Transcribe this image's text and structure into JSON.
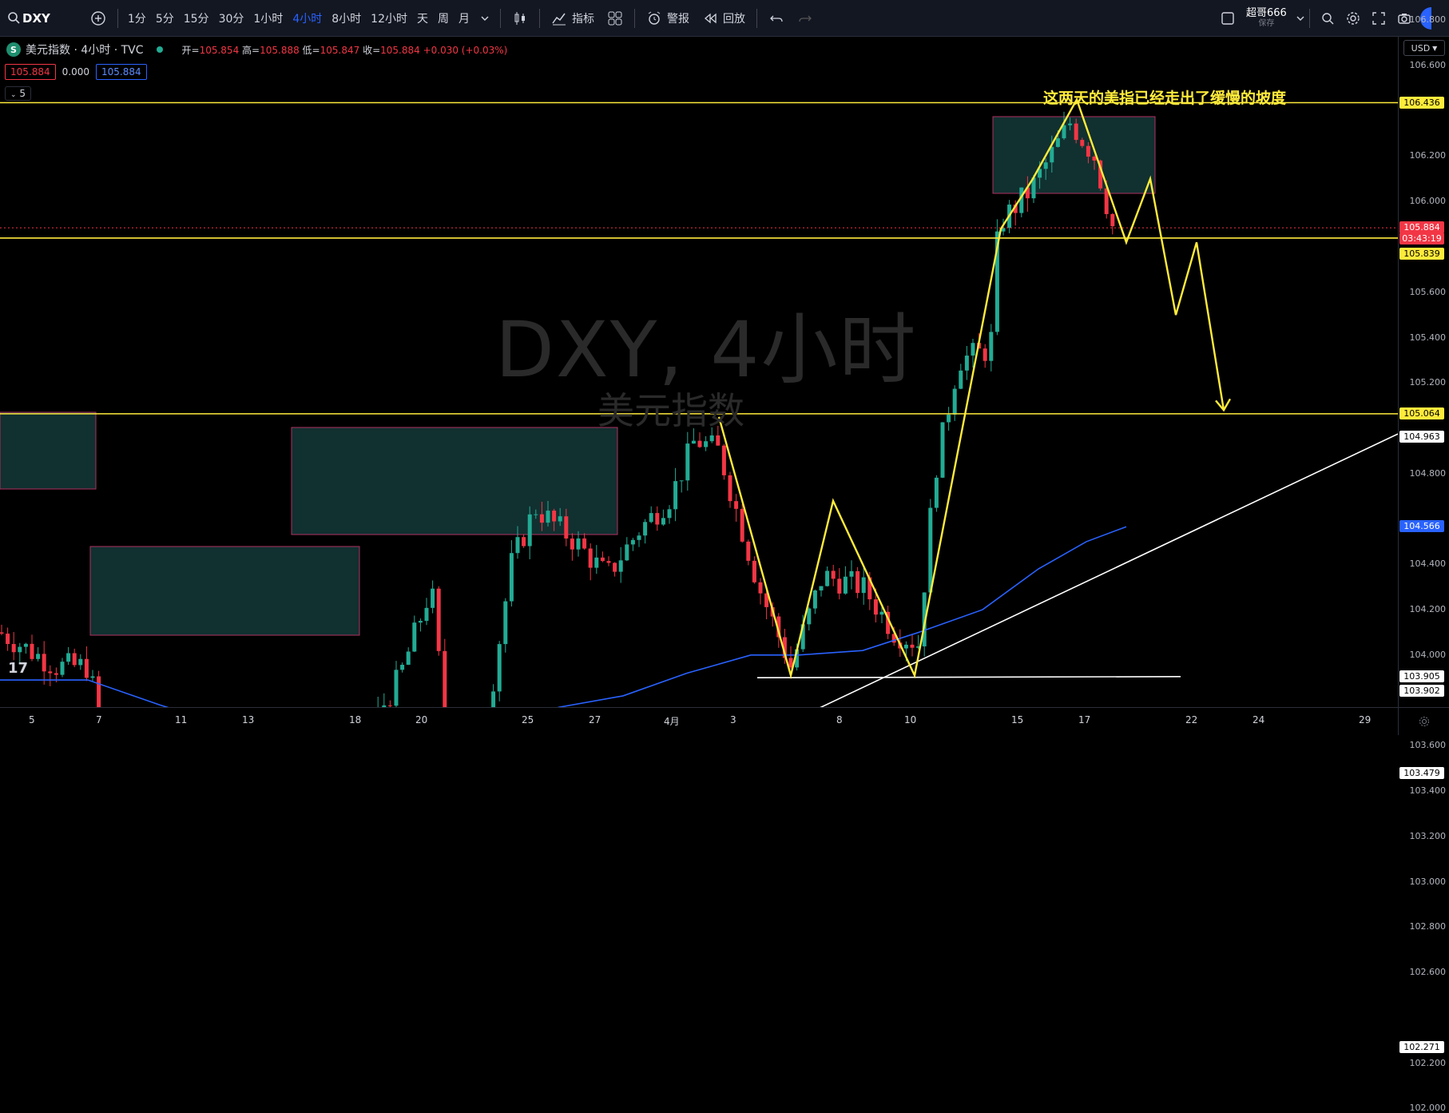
{
  "toolbar": {
    "symbol": "DXY",
    "intervals": [
      "1分",
      "5分",
      "15分",
      "30分",
      "1小时",
      "4小时",
      "8小时",
      "12小时",
      "天",
      "周",
      "月"
    ],
    "active_interval": "4小时",
    "indicators_label": "指标",
    "alert_label": "警报",
    "replay_label": "回放",
    "user_name": "超哥666",
    "save_label": "保存"
  },
  "legend": {
    "symbol_badge": "S",
    "title": "美元指数 · 4小时 · TVC",
    "open_k": "开=",
    "open_v": "105.854",
    "high_k": "高=",
    "high_v": "105.888",
    "low_k": "低=",
    "low_v": "105.847",
    "close_k": "收=",
    "close_v": "105.884",
    "change": "+0.030 (+0.03%)",
    "sell": "105.884",
    "spread": "0.000",
    "buy": "105.884",
    "collapse": "5"
  },
  "watermark": {
    "line1": "DXY, 4小时",
    "line2": "美元指数"
  },
  "annotation": "这两天的美指已经走出了缓慢的坡度",
  "currency": "USD",
  "price_axis": {
    "labels": [
      "106.800",
      "106.600",
      "106.200",
      "106.000",
      "105.600",
      "105.400",
      "105.200",
      "104.800",
      "104.400",
      "104.200",
      "104.000",
      "103.600",
      "103.400",
      "103.200",
      "103.000",
      "102.800",
      "102.600",
      "102.200",
      "102.000"
    ],
    "values": [
      106.8,
      106.6,
      106.2,
      106.0,
      105.6,
      105.4,
      105.2,
      104.8,
      104.4,
      104.2,
      104.0,
      103.6,
      103.4,
      103.2,
      103.0,
      102.8,
      102.6,
      102.2,
      102.0
    ]
  },
  "price_tags": [
    {
      "text": "106.436",
      "value": 106.436,
      "kind": "yellow"
    },
    {
      "text": "105.884",
      "value": 105.884,
      "kind": "red"
    },
    {
      "text": "03:43:19",
      "value": 105.8,
      "kind": "red"
    },
    {
      "text": "105.839",
      "value": 105.839,
      "kind": "yellow"
    },
    {
      "text": "105.064",
      "value": 105.064,
      "kind": "yellow"
    },
    {
      "text": "104.963",
      "value": 104.963,
      "kind": "white"
    },
    {
      "text": "104.566",
      "value": 104.566,
      "kind": "blue"
    },
    {
      "text": "103.905",
      "value": 103.905,
      "kind": "white"
    },
    {
      "text": "103.902",
      "value": 103.902,
      "kind": "white"
    },
    {
      "text": "103.479",
      "value": 103.479,
      "kind": "white"
    },
    {
      "text": "102.271",
      "value": 102.271,
      "kind": "white"
    }
  ],
  "time_axis": [
    "5",
    "7",
    "11",
    "13",
    "18",
    "20",
    "25",
    "27",
    "4月",
    "3",
    "8",
    "10",
    "15",
    "17",
    "22",
    "24",
    "29"
  ],
  "colors": {
    "up": "#22ab94",
    "down": "#f23645",
    "ma": "#2962ff",
    "level": "#ffeb3b",
    "trend": "#ffffff"
  }
}
